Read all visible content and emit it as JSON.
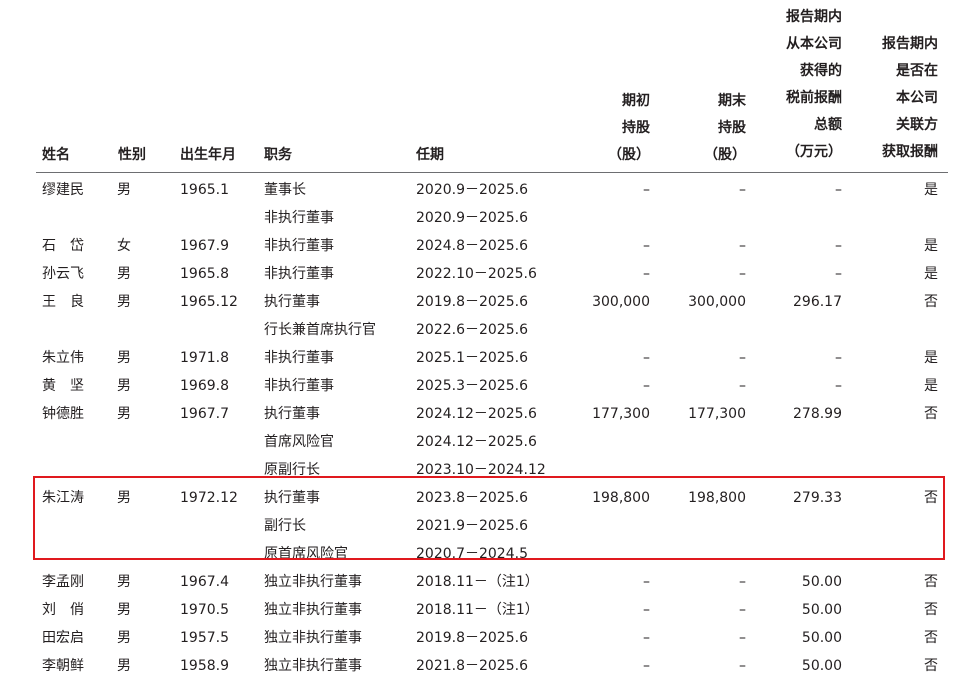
{
  "headers": {
    "name": "姓名",
    "gender": "性别",
    "birth": "出生年月",
    "position": "职务",
    "term": "任期",
    "begin_shares": [
      "期初",
      "持股",
      "（股）"
    ],
    "end_shares": [
      "期末",
      "持股",
      "（股）"
    ],
    "pretax_pay": [
      "报告期内",
      "从本公司",
      "获得的",
      "税前报酬",
      "总额",
      "（万元）"
    ],
    "related_pay": [
      "报告期内",
      "是否在",
      "本公司",
      "关联方",
      "获取报酬"
    ]
  },
  "rows": [
    {
      "name": "缪建民",
      "gender": "男",
      "birth": "1965.1",
      "positions": [
        "董事长",
        "非执行董事"
      ],
      "terms": [
        "2020.9－2025.6",
        "2020.9－2025.6"
      ],
      "begin_shares": "–",
      "end_shares": "–",
      "pretax_pay": "–",
      "related_pay": "是"
    },
    {
      "name": "石　岱",
      "gender": "女",
      "birth": "1967.9",
      "positions": [
        "非执行董事"
      ],
      "terms": [
        "2024.8－2025.6"
      ],
      "begin_shares": "–",
      "end_shares": "–",
      "pretax_pay": "–",
      "related_pay": "是"
    },
    {
      "name": "孙云飞",
      "gender": "男",
      "birth": "1965.8",
      "positions": [
        "非执行董事"
      ],
      "terms": [
        "2022.10－2025.6"
      ],
      "begin_shares": "–",
      "end_shares": "–",
      "pretax_pay": "–",
      "related_pay": "是"
    },
    {
      "name": "王　良",
      "gender": "男",
      "birth": "1965.12",
      "positions": [
        "执行董事",
        "行长兼首席执行官"
      ],
      "terms": [
        "2019.8－2025.6",
        "2022.6－2025.6"
      ],
      "begin_shares": "300,000",
      "end_shares": "300,000",
      "pretax_pay": "296.17",
      "related_pay": "否"
    },
    {
      "name": "朱立伟",
      "gender": "男",
      "birth": "1971.8",
      "positions": [
        "非执行董事"
      ],
      "terms": [
        "2025.1－2025.6"
      ],
      "begin_shares": "–",
      "end_shares": "–",
      "pretax_pay": "–",
      "related_pay": "是"
    },
    {
      "name": "黄　坚",
      "gender": "男",
      "birth": "1969.8",
      "positions": [
        "非执行董事"
      ],
      "terms": [
        "2025.3－2025.6"
      ],
      "begin_shares": "–",
      "end_shares": "–",
      "pretax_pay": "–",
      "related_pay": "是"
    },
    {
      "name": "钟德胜",
      "gender": "男",
      "birth": "1967.7",
      "positions": [
        "执行董事",
        "首席风险官",
        "原副行长"
      ],
      "terms": [
        "2024.12－2025.6",
        "2024.12－2025.6",
        "2023.10－2024.12"
      ],
      "begin_shares": "177,300",
      "end_shares": "177,300",
      "pretax_pay": "278.99",
      "related_pay": "否"
    },
    {
      "name": "朱江涛",
      "gender": "男",
      "birth": "1972.12",
      "positions": [
        "执行董事",
        "副行长",
        "原首席风险官"
      ],
      "terms": [
        "2023.8－2025.6",
        "2021.9－2025.6",
        "2020.7－2024.5"
      ],
      "begin_shares": "198,800",
      "end_shares": "198,800",
      "pretax_pay": "279.33",
      "related_pay": "否"
    },
    {
      "name": "李孟刚",
      "gender": "男",
      "birth": "1967.4",
      "positions": [
        "独立非执行董事"
      ],
      "terms": [
        "2018.11－（注1）"
      ],
      "begin_shares": "–",
      "end_shares": "–",
      "pretax_pay": "50.00",
      "related_pay": "否"
    },
    {
      "name": "刘　俏",
      "gender": "男",
      "birth": "1970.5",
      "positions": [
        "独立非执行董事"
      ],
      "terms": [
        "2018.11－（注1）"
      ],
      "begin_shares": "–",
      "end_shares": "–",
      "pretax_pay": "50.00",
      "related_pay": "否"
    },
    {
      "name": "田宏启",
      "gender": "男",
      "birth": "1957.5",
      "positions": [
        "独立非执行董事"
      ],
      "terms": [
        "2019.8－2025.6"
      ],
      "begin_shares": "–",
      "end_shares": "–",
      "pretax_pay": "50.00",
      "related_pay": "否"
    },
    {
      "name": "李朝鲜",
      "gender": "男",
      "birth": "1958.9",
      "positions": [
        "独立非执行董事"
      ],
      "terms": [
        "2021.8－2025.6"
      ],
      "begin_shares": "–",
      "end_shares": "–",
      "pretax_pay": "50.00",
      "related_pay": "否"
    }
  ],
  "highlighted_row": "朱江涛",
  "colors": {
    "text": "#231f20",
    "rule": "#6d6e71",
    "highlight_border": "#e0191e"
  }
}
